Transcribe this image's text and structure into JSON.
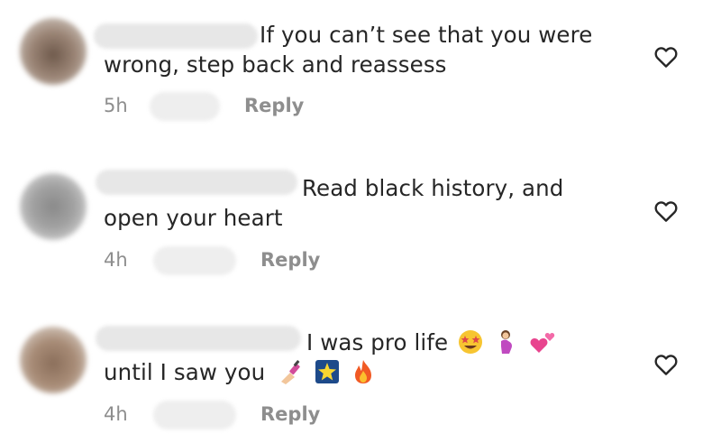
{
  "comments": [
    {
      "text_line1": "If you can’t see that you were",
      "text_line2": "wrong, step back and reassess",
      "time": "5h",
      "reply_label": "Reply",
      "avatar_color": "#8a7466",
      "like_icon": "heart-icon"
    },
    {
      "text_line1": "Read black history, and",
      "text_line2": "open your heart",
      "time": "4h",
      "reply_label": "Reply",
      "avatar_color": "#8c8c8c",
      "like_icon": "heart-icon"
    },
    {
      "text_line1": "I was pro life",
      "text_line2": "until I saw you",
      "time": "4h",
      "reply_label": "Reply",
      "avatar_color": "#9c7f6b",
      "like_icon": "heart-icon",
      "emojis_line1": [
        "star-struck-emoji",
        "pregnant-woman-emoji",
        "two-hearts-emoji"
      ],
      "emojis_line2": [
        "nail-polish-emoji",
        "sparkle-star-emoji",
        "fire-emoji"
      ]
    }
  ],
  "colors": {
    "text": "#262626",
    "secondary": "#8e8e8e",
    "background": "#ffffff"
  }
}
